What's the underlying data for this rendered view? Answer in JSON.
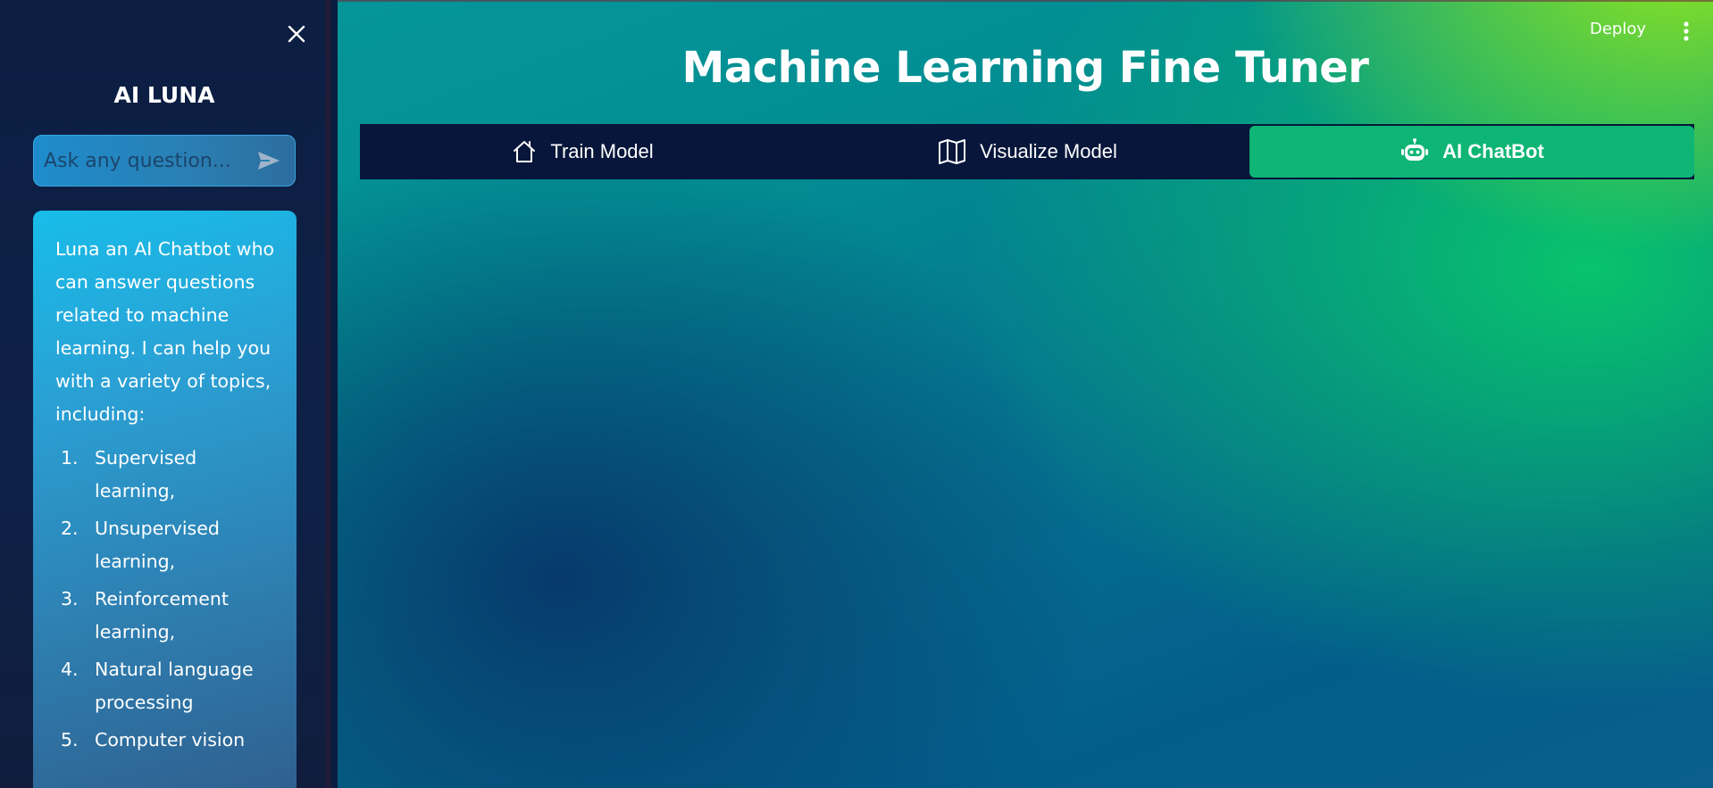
{
  "sidebar": {
    "close_icon": "close-icon",
    "title": "AI LUNA",
    "ask": {
      "value": "",
      "placeholder": "Ask any question...",
      "send_icon": "send-icon"
    },
    "info": {
      "intro": "Luna an AI Chatbot who can answer questions related to machine learning. I can help you with a variety of topics, including:",
      "topics": [
        {
          "num": "1.",
          "label": "Supervised learning,"
        },
        {
          "num": "2.",
          "label": "Unsupervised learning,"
        },
        {
          "num": "3.",
          "label": "Reinforcement learning,"
        },
        {
          "num": "4.",
          "label": "Natural language processing"
        },
        {
          "num": "5.",
          "label": "Computer vision"
        }
      ]
    }
  },
  "header": {
    "deploy_label": "Deploy",
    "more_icon": "more-vertical-icon"
  },
  "main": {
    "title": "Machine Learning Fine Tuner",
    "tabs": [
      {
        "label": "Train Model",
        "icon": "house-icon",
        "active": false
      },
      {
        "label": "Visualize Model",
        "icon": "map-icon",
        "active": false
      },
      {
        "label": "AI ChatBot",
        "icon": "robot-icon",
        "active": true
      }
    ]
  },
  "colors": {
    "sidebar_bg": "#0e2147",
    "active_tab": "#0eb575",
    "tab_bar_bg": "#07163a",
    "card_top": "#18bde9",
    "main_green": "#08c36c",
    "main_lime": "#8ee61f"
  }
}
